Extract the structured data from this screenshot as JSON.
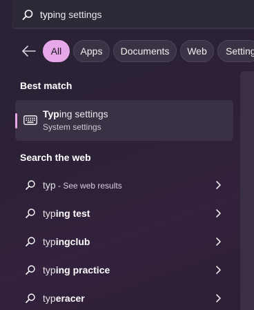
{
  "search": {
    "typed": "typ",
    "completion": "ing settings"
  },
  "filters": [
    {
      "label": "All",
      "active": true
    },
    {
      "label": "Apps",
      "active": false
    },
    {
      "label": "Documents",
      "active": false
    },
    {
      "label": "Web",
      "active": false
    },
    {
      "label": "Setting",
      "active": false
    }
  ],
  "best_match": {
    "heading": "Best match",
    "title_bold": "Typ",
    "title_rest": "ing settings",
    "subtitle": "System settings",
    "icon": "keyboard-icon"
  },
  "web": {
    "heading": "Search the web",
    "items": [
      {
        "prefix": "typ",
        "suffix": " - See web results"
      },
      {
        "prefix": "typ",
        "bold": "ing test"
      },
      {
        "prefix": "typ",
        "bold": "ingclub"
      },
      {
        "prefix": "typ",
        "bold": "ing practice"
      },
      {
        "prefix": "typ",
        "bold": "eracer"
      }
    ]
  },
  "colors": {
    "accent": "#e7a8ea"
  }
}
